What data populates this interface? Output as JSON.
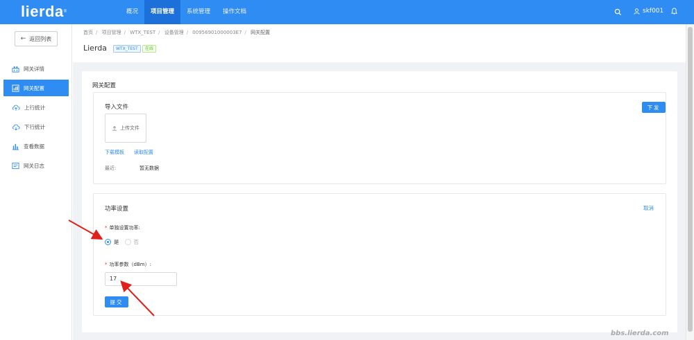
{
  "app": {
    "logo": "lierda",
    "logo_mark": "®",
    "nav": [
      "概况",
      "项目管理",
      "系统管理",
      "操作文档"
    ],
    "active_nav": 1,
    "user": "skf001",
    "accent": "#2f8cf3"
  },
  "sidebar": {
    "back_label": "返回列表",
    "items": [
      {
        "label": "网关详情",
        "icon": "gateway-icon"
      },
      {
        "label": "网关配置",
        "icon": "config-icon"
      },
      {
        "label": "上行统计",
        "icon": "cloud-upload-icon"
      },
      {
        "label": "下行统计",
        "icon": "cloud-download-icon"
      },
      {
        "label": "查看数据",
        "icon": "bar-chart-icon"
      },
      {
        "label": "网关日志",
        "icon": "log-icon"
      }
    ],
    "active_index": 1
  },
  "breadcrumb": [
    "首页",
    "项目管理",
    "WTX_TEST",
    "设备管理",
    "00956901000003E7",
    "网关配置"
  ],
  "header": {
    "title": "Lierda",
    "tag_project": "WTX_TEST",
    "tag_status": "在线"
  },
  "main": {
    "card_title": "网关配置",
    "import": {
      "title": "导入文件",
      "send_button": "下发",
      "upload_label": "上传文件",
      "download_template": "下载模板",
      "read_config": "读取配置",
      "recent_label": "最近:",
      "recent_value": "暂无数据"
    },
    "power": {
      "title": "功率设置",
      "cancel": "取消",
      "single_label": "单独设置功率:",
      "option_yes": "是",
      "option_no": "否",
      "param_label": "功率参数（dBm）:",
      "param_value": "17",
      "submit": "提交"
    }
  },
  "watermark": "bbs.lierda.com"
}
